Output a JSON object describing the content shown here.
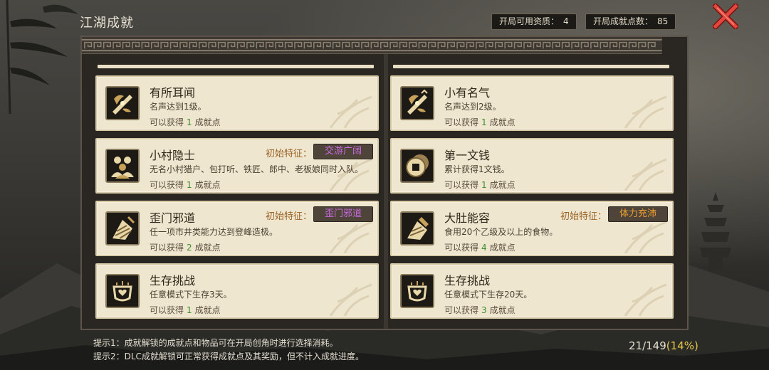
{
  "header": {
    "title": "江湖成就",
    "available_label": "开局可用资质：",
    "available_value": "4",
    "points_label": "开局成就点数：",
    "points_value": "85",
    "close_icon": "close-x-icon"
  },
  "colors": {
    "reward_number": "#3e8e2e",
    "trait_purple": "#c86ae0",
    "trait_orange": "#f0a030",
    "percent": "#e8c84a",
    "card_bg": "#efe6cf"
  },
  "achievements": [
    {
      "title": "有所耳闻",
      "desc": "名声达到1级。",
      "reward_prefix": "可以获得",
      "reward_num": "1",
      "reward_suffix": "成就点",
      "icon": "fame-sword-icon"
    },
    {
      "title": "小有名气",
      "desc": "名声达到2级。",
      "reward_prefix": "可以获得",
      "reward_num": "1",
      "reward_suffix": "成就点",
      "icon": "fame-sword-icon"
    },
    {
      "title": "小村隐士",
      "desc": "无名小村猎户、包打听、铁匠、郎中、老板娘同时入队。",
      "reward_prefix": "可以获得",
      "reward_num": "1",
      "reward_suffix": "成就点",
      "trait_label": "初始特征：",
      "trait": "交游广阔",
      "icon": "villagers-icon"
    },
    {
      "title": "第一文钱",
      "desc": "累计获得1文钱。",
      "reward_prefix": "可以获得",
      "reward_num": "1",
      "reward_suffix": "成就点",
      "icon": "coin-icon"
    },
    {
      "title": "歪门邪道",
      "desc": "任一项市井类能力达到登峰造极。",
      "reward_prefix": "可以获得",
      "reward_num": "2",
      "reward_suffix": "成就点",
      "trait_label": "初始特征：",
      "trait": "歪门邪道",
      "icon": "crooked-path-icon"
    },
    {
      "title": "大肚能容",
      "desc": "食用20个乙级及以上的食物。",
      "reward_prefix": "可以获得",
      "reward_num": "4",
      "reward_suffix": "成就点",
      "trait_label": "初始特征：",
      "trait": "体力充沛",
      "icon": "food-icon"
    },
    {
      "title": "生存挑战",
      "desc": "任意模式下生存3天。",
      "reward_prefix": "可以获得",
      "reward_num": "1",
      "reward_suffix": "成就点",
      "icon": "survival-heart-icon"
    },
    {
      "title": "生存挑战",
      "desc": "任意模式下生存20天。",
      "reward_prefix": "可以获得",
      "reward_num": "3",
      "reward_suffix": "成就点",
      "icon": "survival-heart-icon"
    }
  ],
  "footer": {
    "tip1": "提示1：成就解锁的成就点和物品可在开局创角时进行选择消耗。",
    "tip2": "提示2：DLC成就解锁可正常获得成就点及其奖励，但不计入成就进度。",
    "progress": "21/149",
    "percent": "(14%)"
  }
}
